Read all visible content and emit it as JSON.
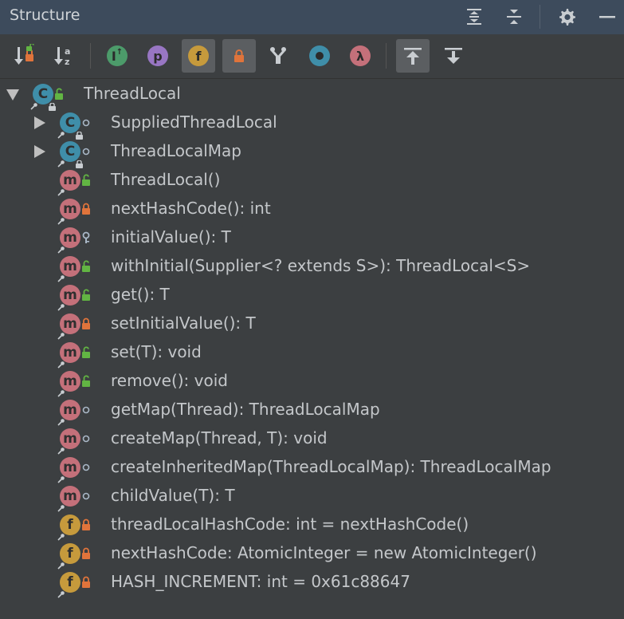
{
  "window": {
    "title": "Structure",
    "buttons": [
      {
        "icon": "expand-all-icon"
      },
      {
        "icon": "collapse-all-icon"
      },
      {
        "icon": "gear-icon"
      },
      {
        "icon": "minimize-icon"
      }
    ]
  },
  "toolbar": {
    "items": [
      {
        "icon": "sort-by-visibility-icon",
        "active": false
      },
      {
        "icon": "sort-alphabetically-icon",
        "active": false
      },
      {
        "icon": "show-inherited-icon",
        "glyph": "I",
        "color": "#4c9b6a",
        "active": false
      },
      {
        "icon": "show-properties-icon",
        "glyph": "p",
        "color": "#9876c3",
        "active": false
      },
      {
        "icon": "show-fields-icon",
        "glyph": "f",
        "color": "#c69a3c",
        "active": true
      },
      {
        "icon": "show-non-public-icon",
        "active": true
      },
      {
        "icon": "show-anonymous-icon",
        "active": false
      },
      {
        "icon": "show-interfaces-icon",
        "color": "#3f8ea9",
        "active": false
      },
      {
        "icon": "show-lambdas-icon",
        "glyph": "λ",
        "color": "#c4707a",
        "active": false
      },
      {
        "icon": "autoscroll-to-source-icon",
        "active": true
      },
      {
        "icon": "autoscroll-from-source-icon",
        "active": false
      }
    ]
  },
  "colors": {
    "public": "#62b543",
    "private": "#e0743b",
    "protected": "#a9b7c6",
    "package": "#a9b7c6"
  },
  "tree": [
    {
      "level": 0,
      "expander": "expanded",
      "kind": "c",
      "kind_label": "C",
      "visibility": "public",
      "label": "ThreadLocal"
    },
    {
      "level": 1,
      "expander": "collapsed",
      "kind": "c",
      "kind_label": "C",
      "visibility": "package",
      "label": "SuppliedThreadLocal"
    },
    {
      "level": 1,
      "expander": "collapsed",
      "kind": "c",
      "kind_label": "C",
      "visibility": "package",
      "label": "ThreadLocalMap"
    },
    {
      "level": 1,
      "expander": "none",
      "kind": "m",
      "kind_label": "m",
      "visibility": "public",
      "label": "ThreadLocal()"
    },
    {
      "level": 1,
      "expander": "none",
      "kind": "m",
      "kind_label": "m",
      "visibility": "private",
      "label": "nextHashCode(): int"
    },
    {
      "level": 1,
      "expander": "none",
      "kind": "m",
      "kind_label": "m",
      "visibility": "protected",
      "label": "initialValue(): T"
    },
    {
      "level": 1,
      "expander": "none",
      "kind": "m",
      "kind_label": "m",
      "visibility": "public",
      "label": "withInitial(Supplier<? extends S>): ThreadLocal<S>"
    },
    {
      "level": 1,
      "expander": "none",
      "kind": "m",
      "kind_label": "m",
      "visibility": "public",
      "label": "get(): T"
    },
    {
      "level": 1,
      "expander": "none",
      "kind": "m",
      "kind_label": "m",
      "visibility": "private",
      "label": "setInitialValue(): T"
    },
    {
      "level": 1,
      "expander": "none",
      "kind": "m",
      "kind_label": "m",
      "visibility": "public",
      "label": "set(T): void"
    },
    {
      "level": 1,
      "expander": "none",
      "kind": "m",
      "kind_label": "m",
      "visibility": "public",
      "label": "remove(): void"
    },
    {
      "level": 1,
      "expander": "none",
      "kind": "m",
      "kind_label": "m",
      "visibility": "package",
      "label": "getMap(Thread): ThreadLocalMap"
    },
    {
      "level": 1,
      "expander": "none",
      "kind": "m",
      "kind_label": "m",
      "visibility": "package",
      "label": "createMap(Thread, T): void"
    },
    {
      "level": 1,
      "expander": "none",
      "kind": "m",
      "kind_label": "m",
      "visibility": "package",
      "label": "createInheritedMap(ThreadLocalMap): ThreadLocalMap"
    },
    {
      "level": 1,
      "expander": "none",
      "kind": "m",
      "kind_label": "m",
      "visibility": "package",
      "label": "childValue(T): T"
    },
    {
      "level": 1,
      "expander": "none",
      "kind": "f",
      "kind_label": "f",
      "visibility": "private",
      "label": "threadLocalHashCode: int = nextHashCode()"
    },
    {
      "level": 1,
      "expander": "none",
      "kind": "f",
      "kind_label": "f",
      "visibility": "private",
      "label": "nextHashCode: AtomicInteger = new AtomicInteger()"
    },
    {
      "level": 1,
      "expander": "none",
      "kind": "f",
      "kind_label": "f",
      "visibility": "private",
      "label": "HASH_INCREMENT: int = 0x61c88647"
    }
  ]
}
